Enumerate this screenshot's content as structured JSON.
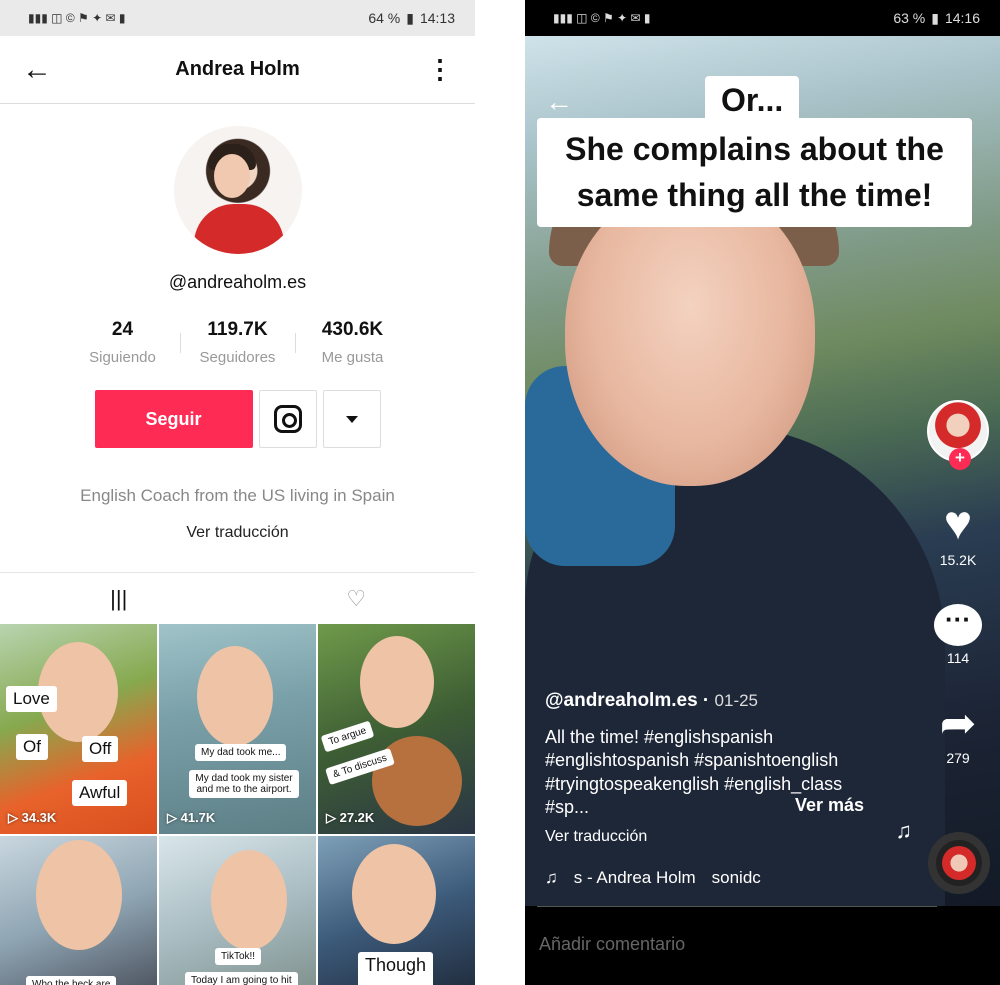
{
  "left": {
    "status": {
      "signal": "▮▮▮ ◫ © ⚑ ✦ ✉ ▮",
      "battery": "64 %",
      "time": "14:13"
    },
    "header": {
      "back_icon": "←",
      "title": "Andrea Holm",
      "more_icon": "⋮"
    },
    "profile": {
      "handle": "@andreaholm.es",
      "stats": [
        {
          "number": "24",
          "label": "Siguiendo"
        },
        {
          "number": "119.7K",
          "label": "Seguidores"
        },
        {
          "number": "430.6K",
          "label": "Me gusta"
        }
      ],
      "follow_label": "Seguir",
      "bio": "English Coach from the US living in Spain",
      "translate_label": "Ver traducción"
    },
    "tabs": {
      "videos_icon": "|||",
      "liked_icon": "♡"
    },
    "grid": [
      {
        "views": "34.3K",
        "tags": [
          "Love",
          "Of",
          "Off",
          "Awful"
        ]
      },
      {
        "views": "41.7K",
        "tags": [
          "My dad took me...",
          "My dad took my sister and me to the airport."
        ]
      },
      {
        "views": "27.2K",
        "tags": [
          "To argue",
          "& To discuss"
        ]
      },
      {
        "views": "",
        "tags": [
          "Who the heck are"
        ]
      },
      {
        "views": "",
        "tags": [
          "TikTok!!",
          "Today I am going to hit"
        ]
      },
      {
        "views": "",
        "tags": [
          "Though"
        ]
      }
    ]
  },
  "right": {
    "status": {
      "signal": "▮▮▮ ◫ © ⚑ ✦ ✉ ▮",
      "battery": "63 %",
      "time": "14:16"
    },
    "caption_top": "Or...",
    "caption_main": "She complains about the same thing all the time!",
    "likes": "15.2K",
    "comments": "114",
    "shares": "279",
    "handle": "@andreaholm.es",
    "date": "01-25",
    "description": "All the time! #englishspanish #englishtospanish #spanishtoenglish #tryingtospeakenglish #english_class #sp...",
    "more_label": "Ver más",
    "translate_label": "Ver traducción",
    "music": "s - Andrea Holm",
    "music_extra": "sonidc",
    "comment_placeholder": "Añadir comentario"
  }
}
